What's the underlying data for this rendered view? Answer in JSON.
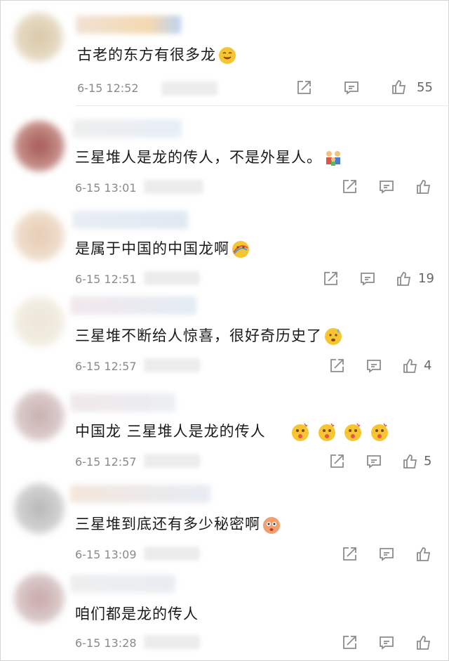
{
  "colors": {
    "text": "#1a1a1a",
    "meta": "#8a8a8a",
    "icon": "#8c8c8c",
    "emoji_yellow": "#f7c531"
  },
  "comments": [
    {
      "text": "古老的东方有很多龙",
      "emojis": [
        "tongue-face-emoji"
      ],
      "time": "6-15 12:52",
      "likes": "55"
    },
    {
      "text": "三星堆人是龙的传人，不是外星人。",
      "emojis": [
        "family-emoji"
      ],
      "time": "6-15 13:01",
      "likes": ""
    },
    {
      "text": "是属于中国的中国龙啊",
      "emojis": [
        "rainbow-face-emoji"
      ],
      "time": "6-15 12:51",
      "likes": "19"
    },
    {
      "text": "三星堆不断给人惊喜，很好奇历史了",
      "emojis": [
        "sweat-face-emoji"
      ],
      "time": "6-15 12:57",
      "likes": "4"
    },
    {
      "text": "中国龙  三星堆人是龙的传人",
      "emojis": [
        "surprised-face-emoji",
        "surprised-face-emoji",
        "surprised-face-emoji",
        "surprised-face-emoji"
      ],
      "time": "6-15 12:57",
      "likes": "5"
    },
    {
      "text": "三星堆到底还有多少秘密啊",
      "emojis": [
        "curious-face-emoji"
      ],
      "time": "6-15 13:09",
      "likes": ""
    },
    {
      "text": "咱们都是龙的传人",
      "emojis": [],
      "time": "6-15 13:28",
      "likes": ""
    }
  ]
}
